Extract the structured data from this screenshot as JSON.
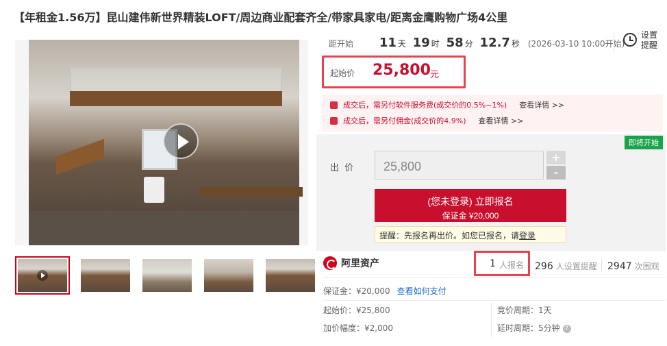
{
  "title": "【年租金1.56万】昆山建伟新世界精装LOFT/周边商业配套齐全/带家具家电/距离金鹰购物广场4公里",
  "countdown": {
    "label": "距开始",
    "days": "11",
    "days_unit": "天",
    "hours": "19",
    "hours_unit": "时",
    "minutes": "58",
    "minutes_unit": "分",
    "seconds": "12.7",
    "seconds_unit": "秒",
    "start_time": "(2026-03-10 10:00开始)"
  },
  "remind": {
    "label": "设置提醒"
  },
  "start_price": {
    "label": "起始价",
    "value": "25,800",
    "unit": "元"
  },
  "fees": [
    {
      "text": "成交后，需另付软件服务费(成交价的0.5%~1%)",
      "detail": "查看详情 >>"
    },
    {
      "text": "成交后，需另付佣金(成交价的4.9%)",
      "detail": "查看详情 >>"
    }
  ],
  "bid": {
    "status_badge": "即将开始",
    "label": "出价",
    "value": "25,800",
    "plus": "+",
    "minus": "-",
    "signup_main": "(您未登录) 立即报名",
    "signup_sub": "保证金 ¥20,000",
    "tip_prefix": "提醒：先报名再出价。如您已报名，请",
    "tip_link": "登录"
  },
  "platform": {
    "name": "阿里资产"
  },
  "stats": {
    "signed_count": "1",
    "signed_label": "人报名",
    "reminders_count": "296",
    "reminders_label": "人设置提醒",
    "viewers_count": "2947",
    "viewers_label": "次围观"
  },
  "details": {
    "deposit": "保证金：¥20,000",
    "deposit_link": "查看如何支付",
    "start_price": "起始价：¥25,800",
    "increment": "加价幅度：¥2,000",
    "bid_period": "竞价周期：1天",
    "delay_period": "延时周期：5分钟"
  },
  "colors": {
    "accent": "#c8102e",
    "highlight_border": "#e8424e",
    "badge_green": "#1aa34a"
  },
  "icons": {
    "remind": "alarm-clock-icon",
    "play": "play-icon",
    "fee": "bag-icon",
    "help": "help-icon",
    "logo": "ali-asset-logo-icon"
  }
}
